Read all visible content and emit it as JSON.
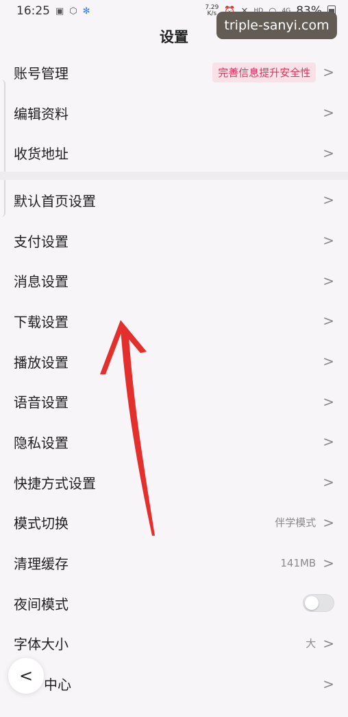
{
  "status_bar": {
    "time": "16:25",
    "net_speed_top": "7.29",
    "net_speed_bottom": "K/s",
    "hd": "HD",
    "network": "4G",
    "battery": "83%"
  },
  "header": {
    "title": "设置"
  },
  "watermark": "triple-sanyi.com",
  "group1": [
    {
      "label": "账号管理",
      "badge": "完善信息提升安全性"
    },
    {
      "label": "编辑资料"
    },
    {
      "label": "收货地址"
    }
  ],
  "group2": [
    {
      "label": "默认首页设置"
    },
    {
      "label": "支付设置"
    },
    {
      "label": "消息设置"
    },
    {
      "label": "下载设置"
    },
    {
      "label": "播放设置"
    },
    {
      "label": "语音设置"
    },
    {
      "label": "隐私设置"
    },
    {
      "label": "快捷方式设置"
    },
    {
      "label": "模式切换",
      "value": "伴学模式"
    },
    {
      "label": "清理缓存",
      "value": "141MB"
    },
    {
      "label": "夜间模式",
      "toggle": false
    },
    {
      "label": "字体大小",
      "value": "大"
    },
    {
      "label": "中心"
    }
  ],
  "chevron": ">",
  "back_glyph": "<",
  "colors": {
    "arrow": "#e3302c",
    "badge_text": "#d8345f",
    "badge_bg": "#f9e2e7"
  }
}
